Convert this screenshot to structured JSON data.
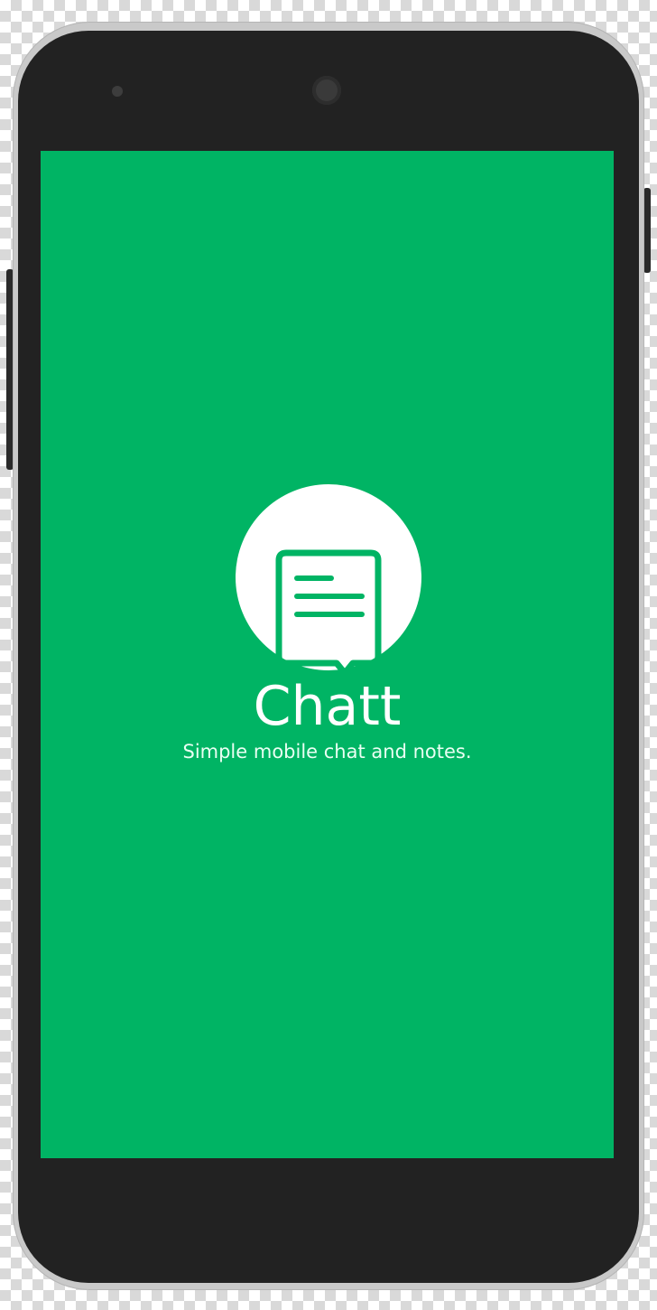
{
  "app": {
    "title": "Chatt",
    "tagline": "Simple mobile chat and notes."
  },
  "icons": {
    "logo": "chat-bubble-icon"
  },
  "colors": {
    "brand_green": "#00b464",
    "device_body": "#222222",
    "logo_background": "#ffffff"
  }
}
